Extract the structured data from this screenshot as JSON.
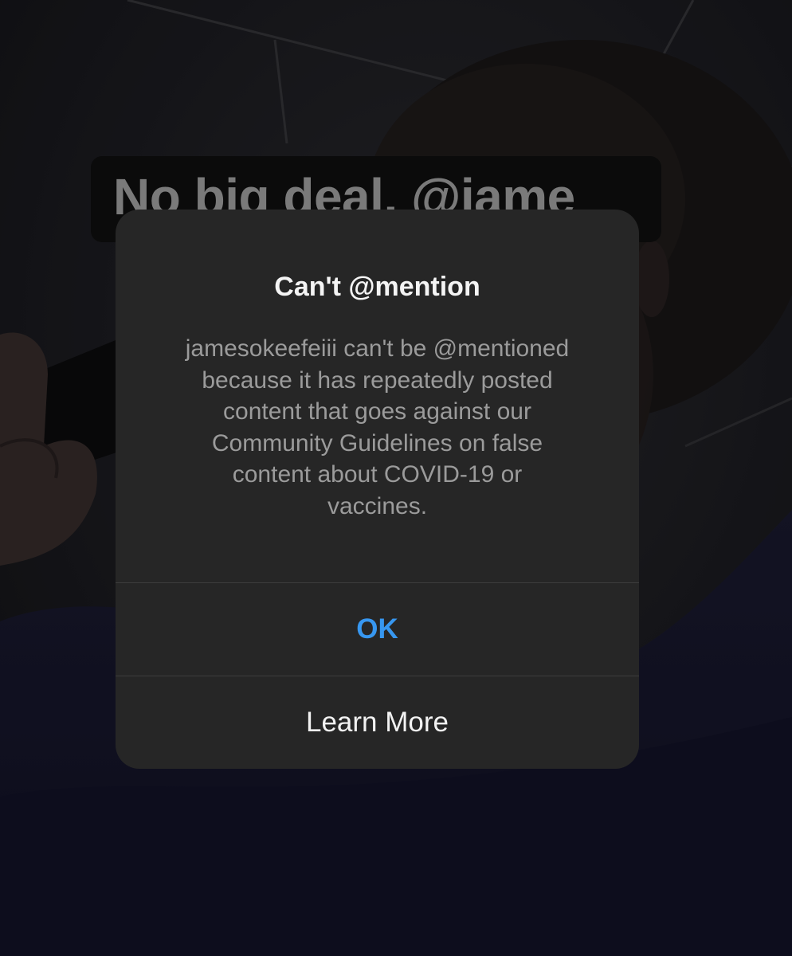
{
  "story": {
    "caption_text": "No big deal, @jame"
  },
  "dialog": {
    "title": "Can't @mention",
    "message_lines": [
      "jamesokeefeiii can't be @mentioned",
      "because it has repeatedly posted",
      "content that goes against our",
      "Community Guidelines on false",
      "content about COVID-19 or",
      "vaccines."
    ],
    "ok_label": "OK",
    "learn_more_label": "Learn More"
  },
  "colors": {
    "ok_accent": "#3797f0",
    "dialog_bg": "#262626"
  }
}
